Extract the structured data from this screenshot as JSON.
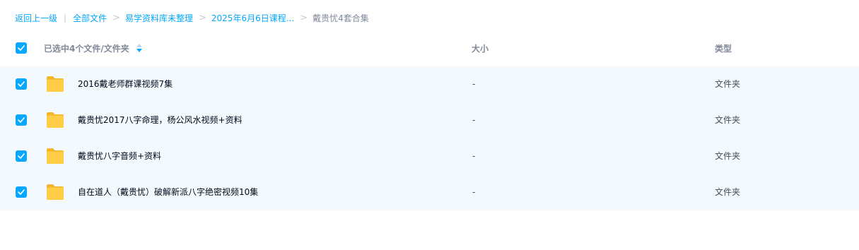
{
  "breadcrumb": {
    "back": "返回上一级",
    "divider": "|",
    "items": [
      {
        "label": "全部文件"
      },
      {
        "label": "易学资料库未整理"
      },
      {
        "label": "2025年6月6日课程..."
      }
    ],
    "separator": ">",
    "current": "戴贵忧4套合集"
  },
  "header": {
    "select_all_checked": true,
    "name_label": "已选中4个文件/文件夹",
    "size_label": "大小",
    "type_label": "类型"
  },
  "files": [
    {
      "name": "2016戴老师群课视频7集",
      "size": "-",
      "type": "文件夹",
      "checked": true,
      "icon": "folder-icon"
    },
    {
      "name": "戴贵忧2017八字命理，杨公风水视频+资料",
      "size": "-",
      "type": "文件夹",
      "checked": true,
      "icon": "folder-icon"
    },
    {
      "name": "戴贵忧八字音频+资料",
      "size": "-",
      "type": "文件夹",
      "checked": true,
      "icon": "folder-icon"
    },
    {
      "name": "自在道人（戴贵忧）破解新派八字绝密视频10集",
      "size": "-",
      "type": "文件夹",
      "checked": true,
      "icon": "folder-icon"
    }
  ],
  "colors": {
    "accent": "#06a7ff",
    "selected_row_bg": "#f3f9fd",
    "folder": "#ffc83d"
  }
}
